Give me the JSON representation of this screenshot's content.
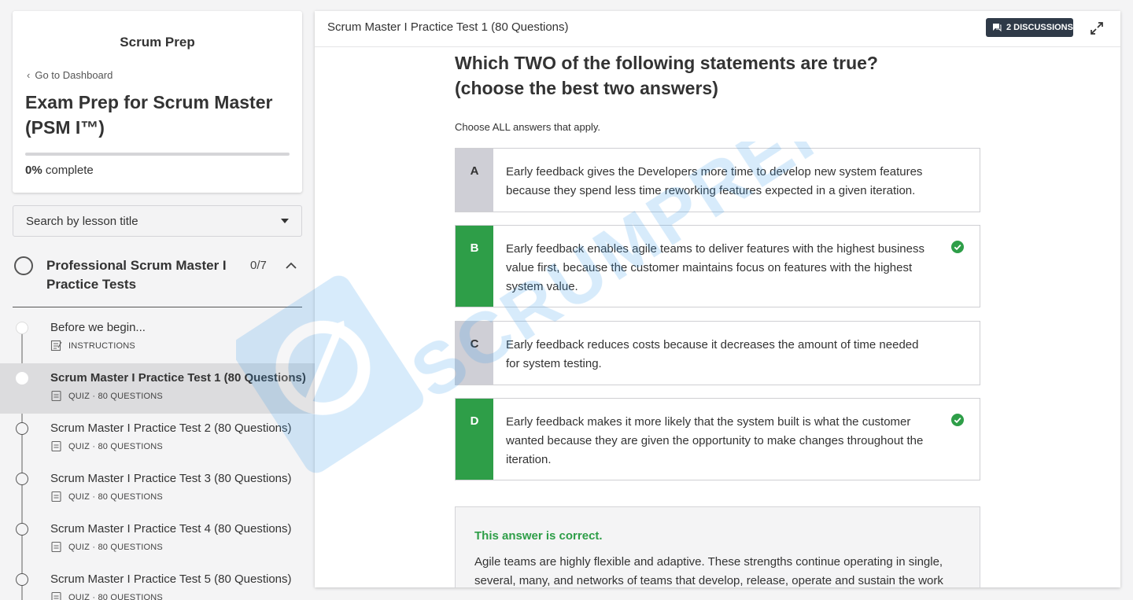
{
  "sidebar": {
    "brand": "Scrum Prep",
    "back_link": "Go to Dashboard",
    "course_title": "Exam Prep for Scrum Master (PSM I™)",
    "progress_value": "0%",
    "progress_suffix": "complete",
    "progress_fraction": 0,
    "search_label": "Search by lesson title",
    "section": {
      "title": "Professional Scrum Master I Practice Tests",
      "count": "0/7"
    },
    "lessons": [
      {
        "title": "Before we begin...",
        "meta": "INSTRUCTIONS",
        "icon": "instructions-icon"
      },
      {
        "title": "Scrum Master I Practice Test 1 (80 Questions)",
        "meta": "QUIZ · 80 QUESTIONS",
        "icon": "quiz-icon"
      },
      {
        "title": "Scrum Master I Practice Test 2 (80 Questions)",
        "meta": "QUIZ · 80 QUESTIONS",
        "icon": "quiz-icon"
      },
      {
        "title": "Scrum Master I Practice Test 3 (80 Questions)",
        "meta": "QUIZ · 80 QUESTIONS",
        "icon": "quiz-icon"
      },
      {
        "title": "Scrum Master I Practice Test 4 (80 Questions)",
        "meta": "QUIZ · 80 QUESTIONS",
        "icon": "quiz-icon"
      },
      {
        "title": "Scrum Master I Practice Test 5 (80 Questions)",
        "meta": "QUIZ · 80 QUESTIONS",
        "icon": "quiz-icon"
      }
    ]
  },
  "main": {
    "title": "Scrum Master I Practice Test 1 (80 Questions)",
    "discussions_label": "2 DISCUSSIONS",
    "question_line1": "Which TWO of the following statements are true?",
    "question_line2": "(choose the best two answers)",
    "instructions": "Choose ALL answers that apply.",
    "answers": [
      {
        "letter": "A",
        "text": "Early feedback gives the Developers more time to develop new system features because they spend less time reworking features expected in a given iteration.",
        "correct": false
      },
      {
        "letter": "B",
        "text": "Early feedback enables agile teams to deliver features with the highest business value first, because the customer maintains focus on features with the highest system value.",
        "correct": true
      },
      {
        "letter": "C",
        "text": "Early feedback reduces costs because it decreases the amount of time needed for system testing.",
        "correct": false
      },
      {
        "letter": "D",
        "text": "Early feedback makes it more likely that the system built is what the customer wanted because they are given the opportunity to make changes throughout the iteration.",
        "correct": true
      }
    ],
    "feedback_head": "This answer is correct.",
    "feedback_text": "Agile teams are highly flexible and adaptive. These strengths continue operating in single, several, many, and networks of teams that develop, release, operate and sustain the work"
  },
  "watermark_text": "SCRUMPREP",
  "colors": {
    "correct_green": "#2e9e48",
    "letter_gray": "#cfcfd6",
    "dark_button": "#2f3a48"
  }
}
